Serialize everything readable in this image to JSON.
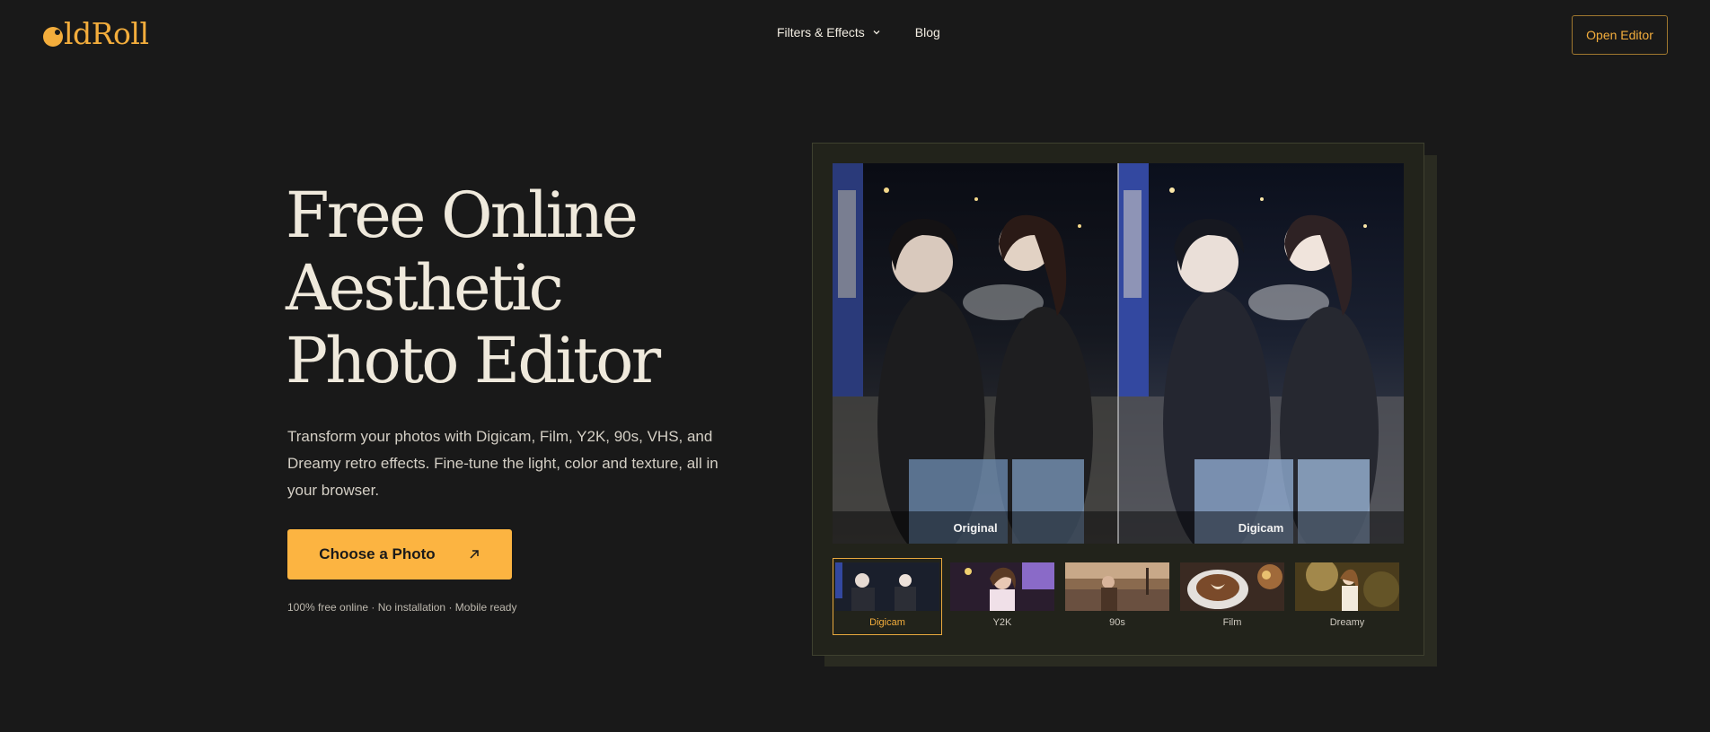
{
  "header": {
    "logo_text": "ldRoll",
    "nav": [
      {
        "label": "Filters & Effects"
      },
      {
        "label": "Blog"
      }
    ],
    "open_editor_label": "Open Editor"
  },
  "hero": {
    "title_lines": [
      "Free Online",
      "Aesthetic",
      "Photo Editor"
    ],
    "description": "Transform your photos with Digicam, Film, Y2K, 90s, VHS, and Dreamy retro effects. Fine-tune the light, color and texture, all in your browser.",
    "cta_label": "Choose a Photo",
    "footnote": "100% free online · No installation · Mobile ready"
  },
  "compare": {
    "left_label": "Original",
    "right_label": "Digicam"
  },
  "filters": [
    {
      "label": "Digicam",
      "active": true
    },
    {
      "label": "Y2K",
      "active": false
    },
    {
      "label": "90s",
      "active": false
    },
    {
      "label": "Film",
      "active": false
    },
    {
      "label": "Dreamy",
      "active": false
    }
  ],
  "colors": {
    "background": "#191919",
    "accent": "#fcb441",
    "panel": "#22231b"
  }
}
